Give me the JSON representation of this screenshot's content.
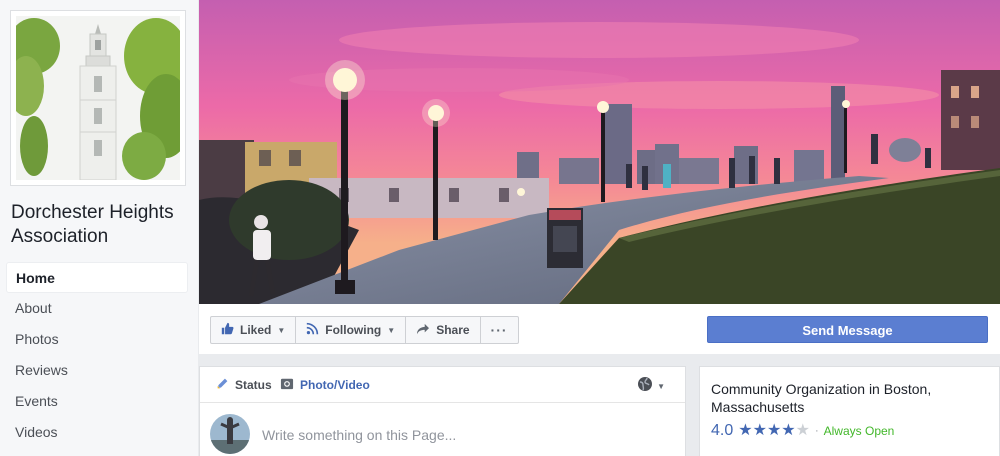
{
  "page": {
    "name": "Dorchester Heights Association"
  },
  "sidebar": {
    "items": [
      {
        "label": "Home",
        "active": true
      },
      {
        "label": "About"
      },
      {
        "label": "Photos"
      },
      {
        "label": "Reviews"
      },
      {
        "label": "Events"
      },
      {
        "label": "Videos"
      }
    ]
  },
  "actions": {
    "liked_label": "Liked",
    "following_label": "Following",
    "share_label": "Share",
    "more_label": "···",
    "send_message_label": "Send Message"
  },
  "composer": {
    "status_label": "Status",
    "photo_video_label": "Photo/Video",
    "placeholder": "Write something on this Page..."
  },
  "about": {
    "category": "Community Organization in Boston, Massachusetts",
    "rating": "4.0",
    "rating_stars": 4,
    "rating_max": 5,
    "separator": "·",
    "open_status": "Always Open"
  },
  "colors": {
    "accent": "#4267b2",
    "send_button": "#5b7ed1",
    "open_green": "#42b72a",
    "background": "#e9ebee"
  },
  "icons": {
    "liked": "thumbs-up-icon",
    "following": "rss-icon",
    "share": "share-arrow-icon",
    "status": "pencil-icon",
    "photo": "camera-icon",
    "audience": "globe-icon"
  }
}
